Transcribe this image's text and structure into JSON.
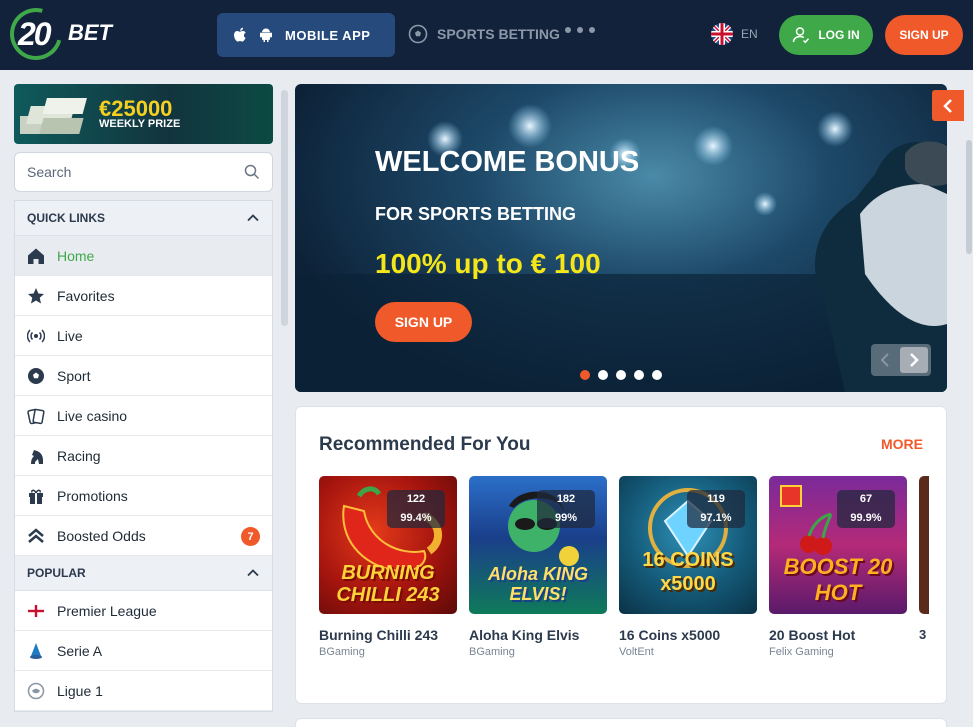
{
  "header": {
    "logo_number": "20",
    "logo_word": "BET",
    "mobile_app": "MOBILE APP",
    "sports_betting": "SPORTS BETTING",
    "language": "EN",
    "login": "LOG IN",
    "signup": "SIGN UP"
  },
  "prize": {
    "amount": "€25000",
    "label": "WEEKLY PRIZE"
  },
  "search": {
    "placeholder": "Search"
  },
  "quick_links": {
    "title": "QUICK LINKS",
    "items": [
      {
        "label": "Home",
        "icon": "home-icon"
      },
      {
        "label": "Favorites",
        "icon": "star-icon"
      },
      {
        "label": "Live",
        "icon": "broadcast-icon"
      },
      {
        "label": "Sport",
        "icon": "soccer-ball-icon"
      },
      {
        "label": "Live casino",
        "icon": "cards-icon"
      },
      {
        "label": "Racing",
        "icon": "horse-icon"
      },
      {
        "label": "Promotions",
        "icon": "gift-icon"
      },
      {
        "label": "Boosted Odds",
        "icon": "double-chevron-up-icon",
        "badge": "7"
      }
    ]
  },
  "popular": {
    "title": "POPULAR",
    "items": [
      {
        "label": "Premier League",
        "icon": "england-flag-icon"
      },
      {
        "label": "Serie A",
        "icon": "serie-a-icon"
      },
      {
        "label": "Ligue 1",
        "icon": "ligue-1-icon"
      }
    ]
  },
  "hero": {
    "title": "WELCOME BONUS",
    "subtitle": "FOR SPORTS BETTING",
    "offer": "100% up to € 100",
    "button": "SIGN UP"
  },
  "recommended": {
    "title": "Recommended For You",
    "more": "MORE",
    "games": [
      {
        "name": "Burning Chilli 243",
        "provider": "BGaming",
        "players": "122",
        "rtp": "99.4%",
        "art": "BURNING CHILLI 243"
      },
      {
        "name": "Aloha King Elvis",
        "provider": "BGaming",
        "players": "182",
        "rtp": "99%",
        "art": "Aloha KING ELVIS!"
      },
      {
        "name": "16 Coins x5000",
        "provider": "VoltEnt",
        "players": "119",
        "rtp": "97.1%",
        "art": "16 COINS x5000"
      },
      {
        "name": "20 Boost Hot",
        "provider": "Felix Gaming",
        "players": "67",
        "rtp": "99.9%",
        "art": "BOOST 20 HOT"
      }
    ],
    "next_peek": "3"
  },
  "colors": {
    "header_bg": "#13223b",
    "accent_green": "#3fa94a",
    "accent_orange": "#f0592a",
    "offer_yellow": "#f5e61a"
  }
}
